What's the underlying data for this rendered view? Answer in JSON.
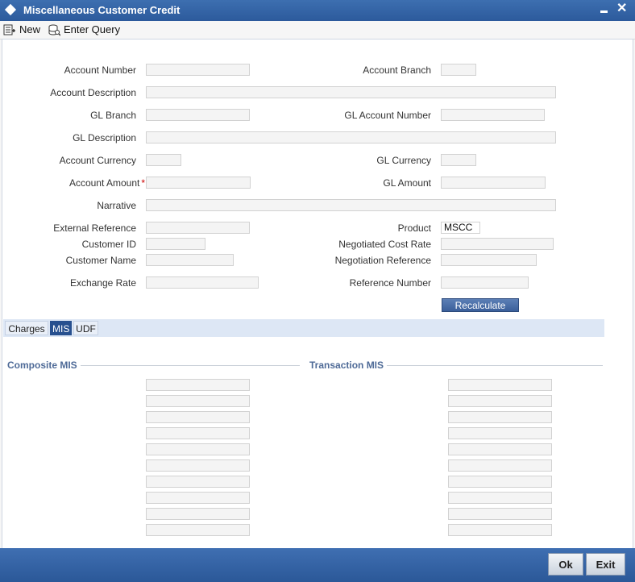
{
  "window": {
    "title": "Miscellaneous Customer Credit"
  },
  "toolbar": {
    "new_label": "New",
    "enter_query_label": "Enter Query"
  },
  "form": {
    "account_number_label": "Account Number",
    "account_branch_label": "Account Branch",
    "account_description_label": "Account Description",
    "gl_branch_label": "GL Branch",
    "gl_account_number_label": "GL Account Number",
    "gl_description_label": "GL Description",
    "account_currency_label": "Account Currency",
    "gl_currency_label": "GL Currency",
    "account_amount_label": "Account Amount",
    "required_marker": "*",
    "gl_amount_label": "GL Amount",
    "narrative_label": "Narrative",
    "external_reference_label": "External Reference",
    "product_label": "Product",
    "product_value": "MSCC",
    "customer_id_label": "Customer ID",
    "negotiated_cost_rate_label": "Negotiated Cost Rate",
    "customer_name_label": "Customer Name",
    "negotiation_reference_label": "Negotiation Reference",
    "exchange_rate_label": "Exchange Rate",
    "reference_number_label": "Reference Number",
    "recalculate_label": "Recalculate"
  },
  "tabs": [
    {
      "label": "Charges",
      "active": false
    },
    {
      "label": "MIS",
      "active": true
    },
    {
      "label": "UDF",
      "active": false
    }
  ],
  "mis": {
    "composite_title": "Composite MIS",
    "transaction_title": "Transaction MIS"
  },
  "footer": {
    "ok_label": "Ok",
    "exit_label": "Exit"
  },
  "colors": {
    "title_bar": "#2c5a9c",
    "active_tab": "#27508f",
    "section_title": "#4e6a97",
    "required": "#cc0000"
  }
}
